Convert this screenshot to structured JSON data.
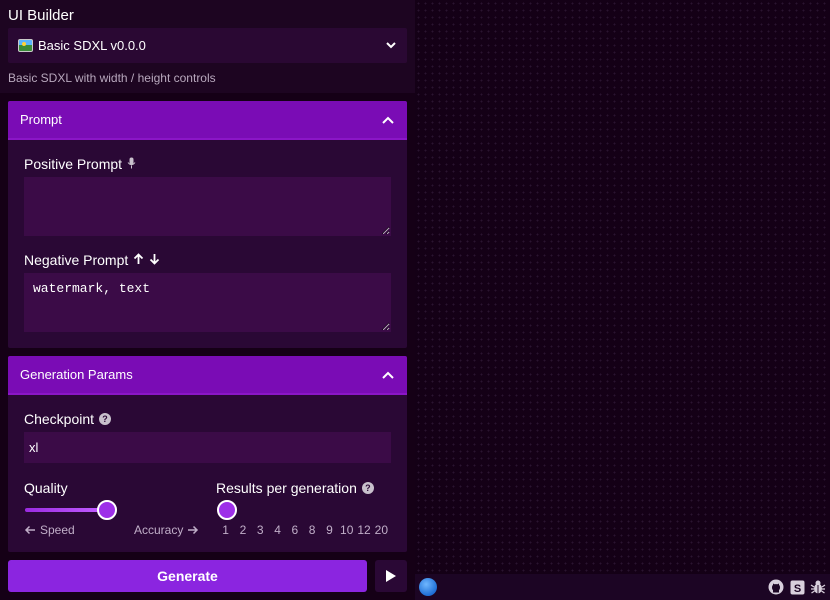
{
  "builder": {
    "label": "UI Builder",
    "selected": "Basic SDXL v0.0.0",
    "description": "Basic SDXL with width / height controls"
  },
  "prompt_section": {
    "title": "Prompt",
    "positive_label": "Positive Prompt",
    "positive_value": "",
    "negative_label": "Negative Prompt",
    "negative_value": "watermark, text"
  },
  "gen_section": {
    "title": "Generation Params",
    "checkpoint_label": "Checkpoint",
    "checkpoint_value": "xl",
    "quality_label": "Quality",
    "quality_level": 0.85,
    "quality_min_label": "Speed",
    "quality_max_label": "Accuracy",
    "results_label": "Results per generation",
    "results_ticks": [
      "1",
      "2",
      "3",
      "4",
      "6",
      "8",
      "9",
      "10",
      "12",
      "20"
    ],
    "results_selected": "1"
  },
  "actions": {
    "generate_label": "Generate"
  },
  "icons": {
    "select_chevron": "chevron-down-icon",
    "collapse": "chevron-up-icon",
    "mic": "microphone-icon",
    "weight_up": "arrow-up-icon",
    "weight_down": "arrow-down-icon",
    "help": "help-icon",
    "play": "play-icon",
    "status": "status-dot-icon",
    "github": "github-icon",
    "stability": "stability-icon",
    "bug": "bug-icon"
  },
  "colors": {
    "accent": "#7a0cb5",
    "button": "#8b25e0",
    "background": "#150016"
  }
}
